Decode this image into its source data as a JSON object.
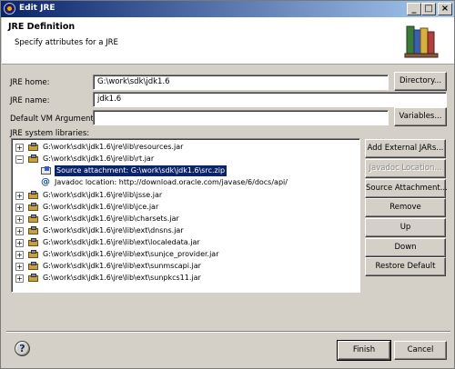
{
  "window": {
    "title": "Edit JRE",
    "controls": {
      "minimize": "_",
      "maximize": "□",
      "close": "×"
    }
  },
  "header": {
    "title": "JRE Definition",
    "subtitle": "Specify attributes for a JRE",
    "icon": "books-icon"
  },
  "form": {
    "jre_home": {
      "label": "JRE home:",
      "value": "G:\\work\\sdk\\jdk1.6",
      "button": "Directory..."
    },
    "jre_name": {
      "label": "JRE name:",
      "value": "jdk1.6"
    },
    "vm_args": {
      "label": "Default VM Arguments:",
      "value": "",
      "button": "Variables..."
    }
  },
  "libraries": {
    "label": "JRE system libraries:",
    "items": [
      {
        "text": "G:\\work\\sdk\\jdk1.6\\jre\\lib\\resources.jar",
        "expanded": false
      },
      {
        "text": "G:\\work\\sdk\\jdk1.6\\jre\\lib\\rt.jar",
        "expanded": true,
        "children": [
          {
            "text": "Source attachment: G:\\work\\sdk\\jdk1.6\\src.zip",
            "selected": true,
            "icon": "source-attachment-icon"
          },
          {
            "text": "Javadoc location: http://download.oracle.com/javase/6/docs/api/",
            "icon": "javadoc-icon"
          }
        ]
      },
      {
        "text": "G:\\work\\sdk\\jdk1.6\\jre\\lib\\jsse.jar",
        "expanded": false
      },
      {
        "text": "G:\\work\\sdk\\jdk1.6\\jre\\lib\\jce.jar",
        "expanded": false
      },
      {
        "text": "G:\\work\\sdk\\jdk1.6\\jre\\lib\\charsets.jar",
        "expanded": false
      },
      {
        "text": "G:\\work\\sdk\\jdk1.6\\jre\\lib\\ext\\dnsns.jar",
        "expanded": false
      },
      {
        "text": "G:\\work\\sdk\\jdk1.6\\jre\\lib\\ext\\localedata.jar",
        "expanded": false
      },
      {
        "text": "G:\\work\\sdk\\jdk1.6\\jre\\lib\\ext\\sunjce_provider.jar",
        "expanded": false
      },
      {
        "text": "G:\\work\\sdk\\jdk1.6\\jre\\lib\\ext\\sunmscapi.jar",
        "expanded": false
      },
      {
        "text": "G:\\work\\sdk\\jdk1.6\\jre\\lib\\ext\\sunpkcs11.jar",
        "expanded": false
      }
    ],
    "buttons": {
      "add_external_jars": "Add External JARs...",
      "javadoc_location": "Javadoc Location...",
      "source_attachment": "Source Attachment...",
      "remove": "Remove",
      "up": "Up",
      "down": "Down",
      "restore_default": "Restore Default"
    }
  },
  "footer": {
    "help": "?",
    "finish": "Finish",
    "cancel": "Cancel"
  },
  "colors": {
    "titlebar_start": "#0a246a",
    "titlebar_end": "#a6caf0",
    "dialog_bg": "#d4d0c8",
    "selection": "#0a246a"
  }
}
